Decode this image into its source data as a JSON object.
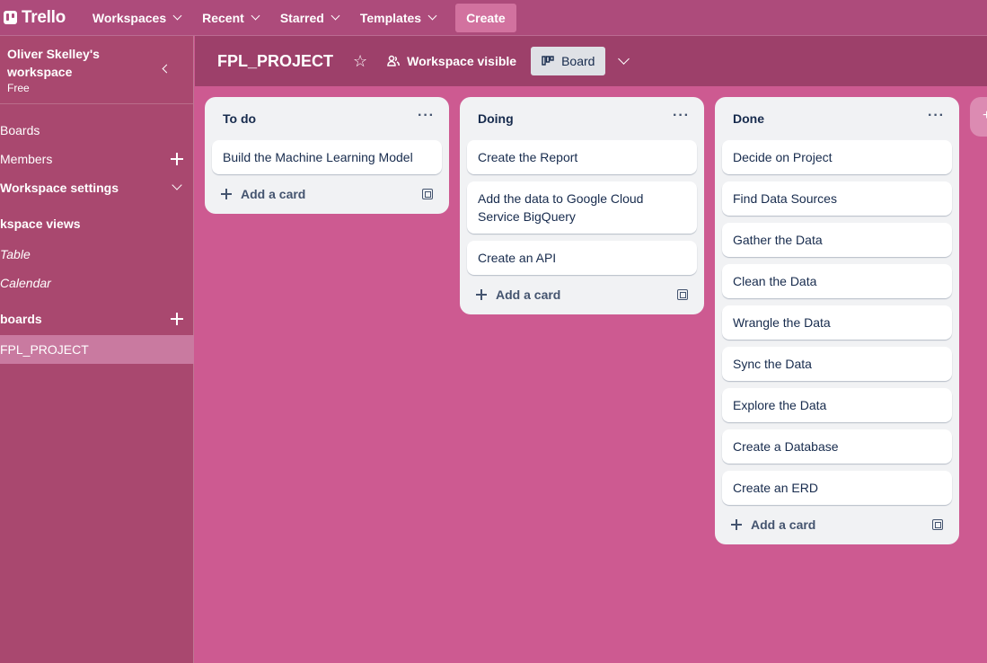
{
  "topnav": {
    "logo": "Trello",
    "items": [
      "Workspaces",
      "Recent",
      "Starred",
      "Templates"
    ],
    "create": "Create"
  },
  "sidebar": {
    "workspace_name": "Oliver Skelley's workspace",
    "plan": "Free",
    "boards": "Boards",
    "members": "Members",
    "settings": "Workspace settings",
    "views_heading": "kspace views",
    "table": "Table",
    "calendar": "Calendar",
    "your_boards": "boards",
    "active_board": "FPL_PROJECT"
  },
  "board": {
    "title": "FPL_PROJECT",
    "visibility": "Workspace visible",
    "view": "Board"
  },
  "lists": [
    {
      "title": "To do",
      "cards": [
        "Build the Machine Learning Model"
      ],
      "add": "Add a card"
    },
    {
      "title": "Doing",
      "cards": [
        "Create the Report",
        "Add the data to Google Cloud Service BigQuery",
        "Create an API"
      ],
      "add": "Add a card"
    },
    {
      "title": "Done",
      "cards": [
        "Decide on Project",
        "Find Data Sources",
        "Gather the Data",
        "Clean the Data",
        "Wrangle the Data",
        "Sync the Data",
        "Explore the Data",
        "Create a Database",
        "Create an ERD"
      ],
      "add": "Add a card"
    }
  ],
  "colors": {
    "background": "#cd5a91",
    "header": "#ad4b7b",
    "sidebar": "#a9486f",
    "board_bar": "#9d406a"
  }
}
